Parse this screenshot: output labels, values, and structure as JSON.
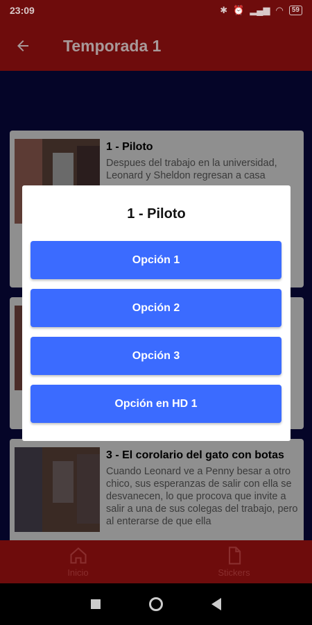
{
  "status": {
    "time": "23:09",
    "battery": "59"
  },
  "appbar": {
    "title": "Temporada 1"
  },
  "episodes": [
    {
      "title": "1 - Piloto",
      "description": "Despues del trabajo en la universidad, Leonard y Sheldon regresan a casa"
    },
    {
      "title": "3 - El corolario del gato con botas",
      "description": "Cuando Leonard ve a Penny besar a otro chico, sus esperanzas de salir con ella se desvanecen, lo que procova que invite a salir a una de sus colegas del trabajo, pero al enterarse de que ella"
    }
  ],
  "dialog": {
    "title": "1 - Piloto",
    "options": [
      "Opción 1",
      "Opción 2",
      "Opción 3",
      "Opción en HD 1"
    ]
  },
  "bottom_nav": {
    "home_label": "Inicio",
    "stickers_label": "Stickers"
  },
  "colors": {
    "appbar": "#6e0c0c",
    "button": "#3b6bff",
    "background": "#050528"
  }
}
